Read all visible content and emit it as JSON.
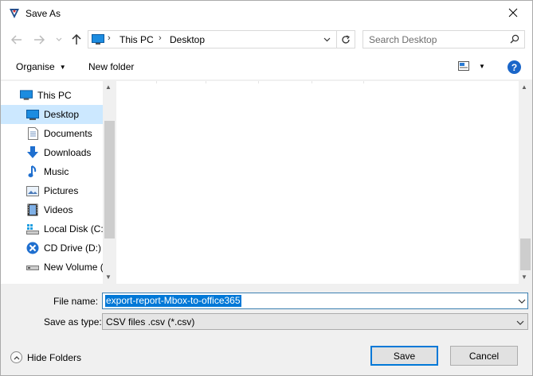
{
  "window": {
    "title": "Save As"
  },
  "address": {
    "crumbs": [
      "This PC",
      "Desktop"
    ]
  },
  "search": {
    "placeholder": "Search Desktop"
  },
  "toolbar": {
    "organise": "Organise",
    "new_folder": "New folder"
  },
  "nav": {
    "root": "This PC",
    "items": [
      {
        "label": "Desktop",
        "icon": "desktop-icon",
        "selected": true
      },
      {
        "label": "Documents",
        "icon": "documents-icon"
      },
      {
        "label": "Downloads",
        "icon": "downloads-icon"
      },
      {
        "label": "Music",
        "icon": "music-icon"
      },
      {
        "label": "Pictures",
        "icon": "pictures-icon"
      },
      {
        "label": "Videos",
        "icon": "videos-icon"
      },
      {
        "label": "Local Disk (C:)",
        "icon": "local-disk-icon"
      },
      {
        "label": "CD Drive (D:) X",
        "icon": "cd-drive-icon"
      },
      {
        "label": "New Volume (",
        "icon": "new-volume-icon"
      }
    ]
  },
  "form": {
    "file_name_label": "File name:",
    "file_name_value": "export-report-Mbox-to-office365",
    "save_type_label": "Save as type:",
    "save_type_value": "CSV files .csv (*.csv)"
  },
  "footer": {
    "hide_folders": "Hide Folders",
    "save": "Save",
    "cancel": "Cancel"
  },
  "colors": {
    "accent": "#0078d7",
    "selection_bg": "#cce8ff",
    "help": "#1a66c9"
  }
}
